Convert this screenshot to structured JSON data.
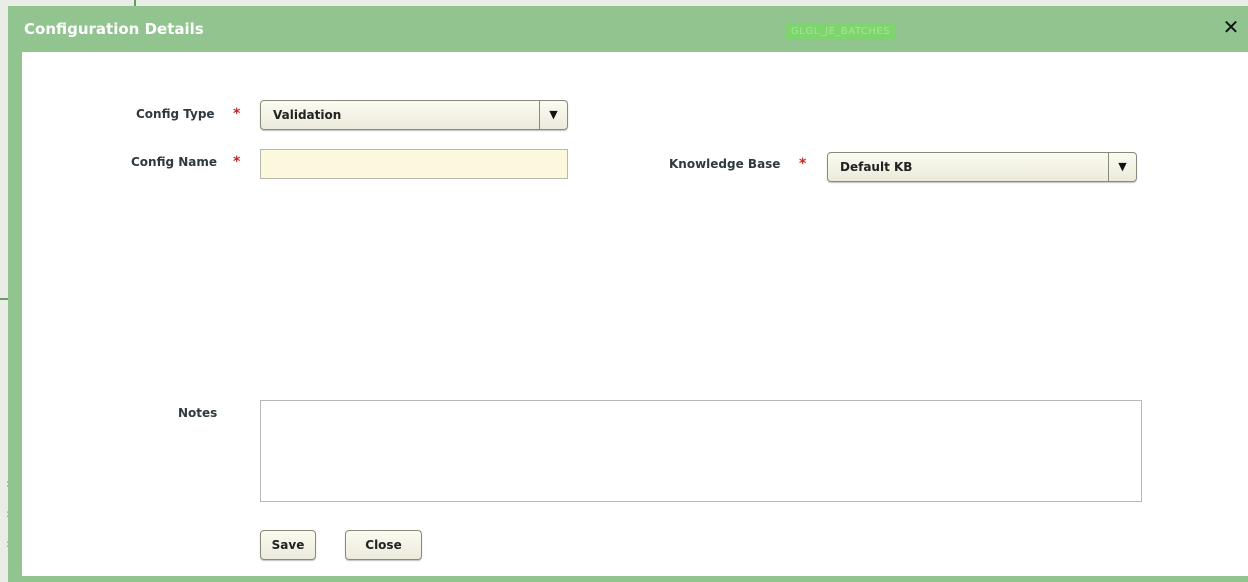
{
  "dialog": {
    "title": "Configuration Details",
    "title_tag": "GLGL_JE_BATCHES",
    "close_glyph": "✕"
  },
  "form": {
    "config_type": {
      "label": "Config Type",
      "required_mark": "*",
      "value": "Validation",
      "arrow": "▼"
    },
    "config_name": {
      "label": "Config Name",
      "required_mark": "*",
      "value": "",
      "placeholder": ""
    },
    "knowledge_base": {
      "label": "Knowledge Base",
      "required_mark": "*",
      "value": "Default KB",
      "arrow": "▼"
    },
    "notes": {
      "label": "Notes",
      "value": ""
    }
  },
  "buttons": {
    "save_label": "Save",
    "close_label": "Close"
  },
  "colors": {
    "title_bar": "#92c48f",
    "required": "#cc2222",
    "input_bg": "#fbf8de"
  }
}
